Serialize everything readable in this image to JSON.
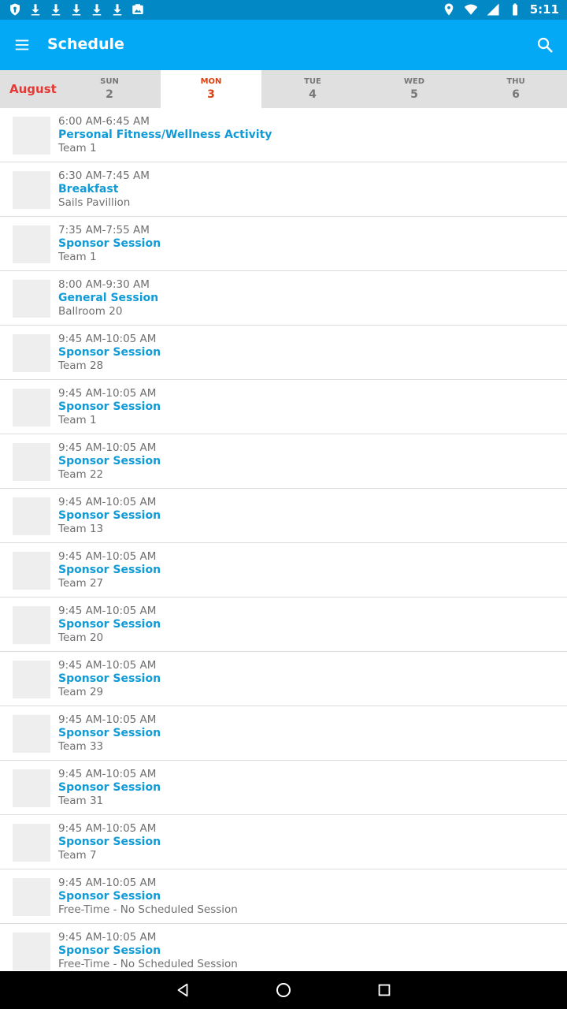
{
  "status_bar": {
    "time": "5:11",
    "left_icons": [
      "shield-icon",
      "download-icon",
      "download-icon",
      "download-icon",
      "download-icon",
      "download-icon",
      "photo-icon"
    ],
    "right_icons": [
      "location-icon",
      "wifi-icon",
      "cell-signal-icon",
      "battery-icon"
    ]
  },
  "app_bar": {
    "title": "Schedule",
    "menu_icon": "menu-icon",
    "search_icon": "search-icon"
  },
  "date_strip": {
    "month": "August",
    "days": [
      {
        "dow": "SUN",
        "num": "2",
        "selected": false
      },
      {
        "dow": "MON",
        "num": "3",
        "selected": true
      },
      {
        "dow": "TUE",
        "num": "4",
        "selected": false
      },
      {
        "dow": "WED",
        "num": "5",
        "selected": false
      },
      {
        "dow": "THU",
        "num": "6",
        "selected": false
      }
    ]
  },
  "sessions": [
    {
      "time": "6:00 AM-6:45 AM",
      "title": "Personal Fitness/Wellness Activity",
      "location": "Team 1"
    },
    {
      "time": "6:30 AM-7:45 AM",
      "title": "Breakfast",
      "location": "Sails Pavillion"
    },
    {
      "time": "7:35 AM-7:55 AM",
      "title": "Sponsor Session",
      "location": "Team 1"
    },
    {
      "time": "8:00 AM-9:30 AM",
      "title": "General Session",
      "location": "Ballroom 20"
    },
    {
      "time": "9:45 AM-10:05 AM",
      "title": "Sponsor Session",
      "location": "Team 28"
    },
    {
      "time": "9:45 AM-10:05 AM",
      "title": "Sponsor Session",
      "location": "Team 1"
    },
    {
      "time": "9:45 AM-10:05 AM",
      "title": "Sponsor Session",
      "location": "Team 22"
    },
    {
      "time": "9:45 AM-10:05 AM",
      "title": "Sponsor Session",
      "location": "Team 13"
    },
    {
      "time": "9:45 AM-10:05 AM",
      "title": "Sponsor Session",
      "location": "Team 27"
    },
    {
      "time": "9:45 AM-10:05 AM",
      "title": "Sponsor Session",
      "location": "Team 20"
    },
    {
      "time": "9:45 AM-10:05 AM",
      "title": "Sponsor Session",
      "location": "Team 29"
    },
    {
      "time": "9:45 AM-10:05 AM",
      "title": "Sponsor Session",
      "location": "Team 33"
    },
    {
      "time": "9:45 AM-10:05 AM",
      "title": "Sponsor Session",
      "location": "Team 31"
    },
    {
      "time": "9:45 AM-10:05 AM",
      "title": "Sponsor Session",
      "location": "Team 7"
    },
    {
      "time": "9:45 AM-10:05 AM",
      "title": "Sponsor Session",
      "location": "Free-Time - No Scheduled Session"
    },
    {
      "time": "9:45 AM-10:05 AM",
      "title": "Sponsor Session",
      "location": "Free-Time - No Scheduled Session"
    }
  ],
  "nav_bar": {
    "back_icon": "back-icon",
    "home_icon": "home-icon",
    "recents_icon": "recents-icon"
  },
  "colors": {
    "status_bar": "#0288c4",
    "app_bar": "#03a9f4",
    "accent_title": "#0f9bd7",
    "month": "#e53935",
    "selected_day": "#d84315"
  }
}
